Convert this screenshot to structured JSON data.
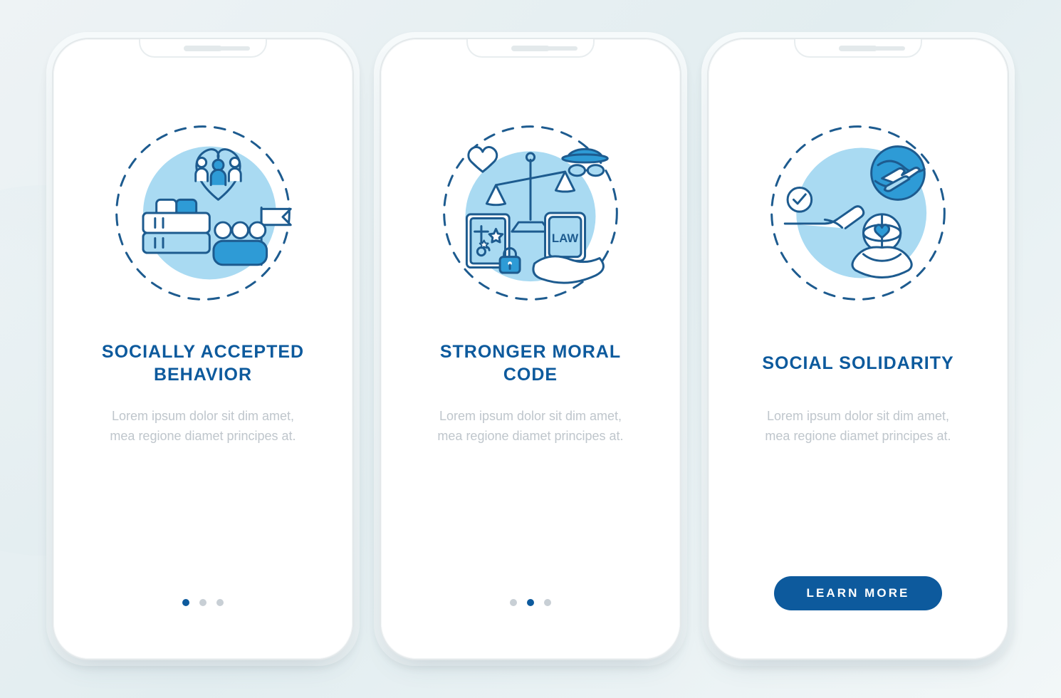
{
  "colors": {
    "primary": "#0d5a9d",
    "outline": "#1d5b8f",
    "light": "#a9daf2",
    "mid": "#2e9bd6",
    "muted": "#bfc6cc"
  },
  "screens": [
    {
      "icon": "community-icon",
      "title": "SOCIALLY ACCEPTED BEHAVIOR",
      "description": "Lorem ipsum dolor sit dim amet, mea regione diamet principes at.",
      "activeDot": 0,
      "cta": null
    },
    {
      "icon": "moral-code-icon",
      "title": "STRONGER MORAL CODE",
      "description": "Lorem ipsum dolor sit dim amet, mea regione diamet principes at.",
      "activeDot": 1,
      "cta": null,
      "lawLabel": "LAW"
    },
    {
      "icon": "solidarity-icon",
      "title": "SOCIAL SOLIDARITY",
      "description": "Lorem ipsum dolor sit dim amet, mea regione diamet principes at.",
      "activeDot": null,
      "cta": "LEARN MORE"
    }
  ]
}
